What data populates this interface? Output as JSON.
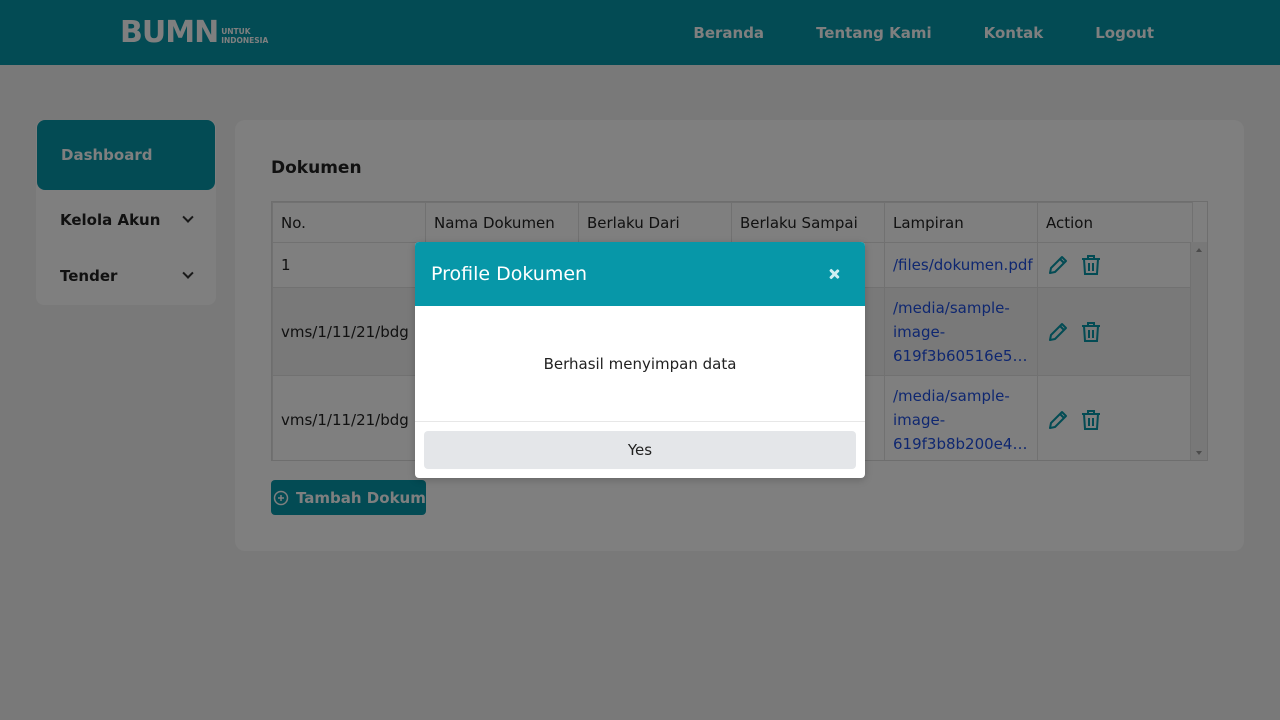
{
  "navbar": {
    "logo": {
      "main": "BUMN",
      "sub_line1": "UNTUK",
      "sub_line2": "INDONESIA"
    },
    "links": [
      "Beranda",
      "Tentang Kami",
      "Kontak",
      "Logout"
    ]
  },
  "sidebar": {
    "active": "Dashboard",
    "items": [
      {
        "label": "Kelola Akun",
        "icon": "chevron-down-icon"
      },
      {
        "label": "Tender",
        "icon": "chevron-down-icon"
      }
    ]
  },
  "main": {
    "title": "Dokumen",
    "table": {
      "headers": [
        "No.",
        "Nama Dokumen",
        "Berlaku Dari",
        "Berlaku Sampai",
        "Lampiran",
        "Action"
      ],
      "rows": [
        {
          "no": "1",
          "lampiran_line1": "/files/dokumen.pdf",
          "lampiran_line2": "",
          "lampiran_line3": ""
        },
        {
          "no": "vms/1/11/21/bdg",
          "lampiran_line1": "/media/sample-",
          "lampiran_line2": "image-",
          "lampiran_line3": "619f3b60516e55..."
        },
        {
          "no": "vms/1/11/21/bdg",
          "lampiran_line1": "/media/sample-",
          "lampiran_line2": "image-",
          "lampiran_line3": "619f3b8b200e44..."
        }
      ]
    },
    "add_button": "Tambah Dokumen"
  },
  "modal": {
    "title": "Profile Dokumen",
    "message": "Berhasil menyimpan data",
    "confirm": "Yes"
  },
  "colors": {
    "primary": "#0797a8",
    "link": "#1f4fe0",
    "backdrop": "rgba(0,0,0,0.5)"
  }
}
